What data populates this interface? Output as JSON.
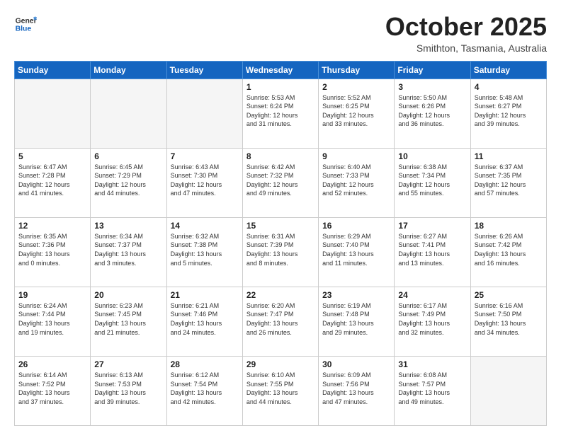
{
  "header": {
    "logo_general": "General",
    "logo_blue": "Blue",
    "month_title": "October 2025",
    "location": "Smithton, Tasmania, Australia"
  },
  "days_of_week": [
    "Sunday",
    "Monday",
    "Tuesday",
    "Wednesday",
    "Thursday",
    "Friday",
    "Saturday"
  ],
  "weeks": [
    [
      {
        "day": "",
        "info": ""
      },
      {
        "day": "",
        "info": ""
      },
      {
        "day": "",
        "info": ""
      },
      {
        "day": "1",
        "info": "Sunrise: 5:53 AM\nSunset: 6:24 PM\nDaylight: 12 hours\nand 31 minutes."
      },
      {
        "day": "2",
        "info": "Sunrise: 5:52 AM\nSunset: 6:25 PM\nDaylight: 12 hours\nand 33 minutes."
      },
      {
        "day": "3",
        "info": "Sunrise: 5:50 AM\nSunset: 6:26 PM\nDaylight: 12 hours\nand 36 minutes."
      },
      {
        "day": "4",
        "info": "Sunrise: 5:48 AM\nSunset: 6:27 PM\nDaylight: 12 hours\nand 39 minutes."
      }
    ],
    [
      {
        "day": "5",
        "info": "Sunrise: 6:47 AM\nSunset: 7:28 PM\nDaylight: 12 hours\nand 41 minutes."
      },
      {
        "day": "6",
        "info": "Sunrise: 6:45 AM\nSunset: 7:29 PM\nDaylight: 12 hours\nand 44 minutes."
      },
      {
        "day": "7",
        "info": "Sunrise: 6:43 AM\nSunset: 7:30 PM\nDaylight: 12 hours\nand 47 minutes."
      },
      {
        "day": "8",
        "info": "Sunrise: 6:42 AM\nSunset: 7:32 PM\nDaylight: 12 hours\nand 49 minutes."
      },
      {
        "day": "9",
        "info": "Sunrise: 6:40 AM\nSunset: 7:33 PM\nDaylight: 12 hours\nand 52 minutes."
      },
      {
        "day": "10",
        "info": "Sunrise: 6:38 AM\nSunset: 7:34 PM\nDaylight: 12 hours\nand 55 minutes."
      },
      {
        "day": "11",
        "info": "Sunrise: 6:37 AM\nSunset: 7:35 PM\nDaylight: 12 hours\nand 57 minutes."
      }
    ],
    [
      {
        "day": "12",
        "info": "Sunrise: 6:35 AM\nSunset: 7:36 PM\nDaylight: 13 hours\nand 0 minutes."
      },
      {
        "day": "13",
        "info": "Sunrise: 6:34 AM\nSunset: 7:37 PM\nDaylight: 13 hours\nand 3 minutes."
      },
      {
        "day": "14",
        "info": "Sunrise: 6:32 AM\nSunset: 7:38 PM\nDaylight: 13 hours\nand 5 minutes."
      },
      {
        "day": "15",
        "info": "Sunrise: 6:31 AM\nSunset: 7:39 PM\nDaylight: 13 hours\nand 8 minutes."
      },
      {
        "day": "16",
        "info": "Sunrise: 6:29 AM\nSunset: 7:40 PM\nDaylight: 13 hours\nand 11 minutes."
      },
      {
        "day": "17",
        "info": "Sunrise: 6:27 AM\nSunset: 7:41 PM\nDaylight: 13 hours\nand 13 minutes."
      },
      {
        "day": "18",
        "info": "Sunrise: 6:26 AM\nSunset: 7:42 PM\nDaylight: 13 hours\nand 16 minutes."
      }
    ],
    [
      {
        "day": "19",
        "info": "Sunrise: 6:24 AM\nSunset: 7:44 PM\nDaylight: 13 hours\nand 19 minutes."
      },
      {
        "day": "20",
        "info": "Sunrise: 6:23 AM\nSunset: 7:45 PM\nDaylight: 13 hours\nand 21 minutes."
      },
      {
        "day": "21",
        "info": "Sunrise: 6:21 AM\nSunset: 7:46 PM\nDaylight: 13 hours\nand 24 minutes."
      },
      {
        "day": "22",
        "info": "Sunrise: 6:20 AM\nSunset: 7:47 PM\nDaylight: 13 hours\nand 26 minutes."
      },
      {
        "day": "23",
        "info": "Sunrise: 6:19 AM\nSunset: 7:48 PM\nDaylight: 13 hours\nand 29 minutes."
      },
      {
        "day": "24",
        "info": "Sunrise: 6:17 AM\nSunset: 7:49 PM\nDaylight: 13 hours\nand 32 minutes."
      },
      {
        "day": "25",
        "info": "Sunrise: 6:16 AM\nSunset: 7:50 PM\nDaylight: 13 hours\nand 34 minutes."
      }
    ],
    [
      {
        "day": "26",
        "info": "Sunrise: 6:14 AM\nSunset: 7:52 PM\nDaylight: 13 hours\nand 37 minutes."
      },
      {
        "day": "27",
        "info": "Sunrise: 6:13 AM\nSunset: 7:53 PM\nDaylight: 13 hours\nand 39 minutes."
      },
      {
        "day": "28",
        "info": "Sunrise: 6:12 AM\nSunset: 7:54 PM\nDaylight: 13 hours\nand 42 minutes."
      },
      {
        "day": "29",
        "info": "Sunrise: 6:10 AM\nSunset: 7:55 PM\nDaylight: 13 hours\nand 44 minutes."
      },
      {
        "day": "30",
        "info": "Sunrise: 6:09 AM\nSunset: 7:56 PM\nDaylight: 13 hours\nand 47 minutes."
      },
      {
        "day": "31",
        "info": "Sunrise: 6:08 AM\nSunset: 7:57 PM\nDaylight: 13 hours\nand 49 minutes."
      },
      {
        "day": "",
        "info": ""
      }
    ]
  ]
}
